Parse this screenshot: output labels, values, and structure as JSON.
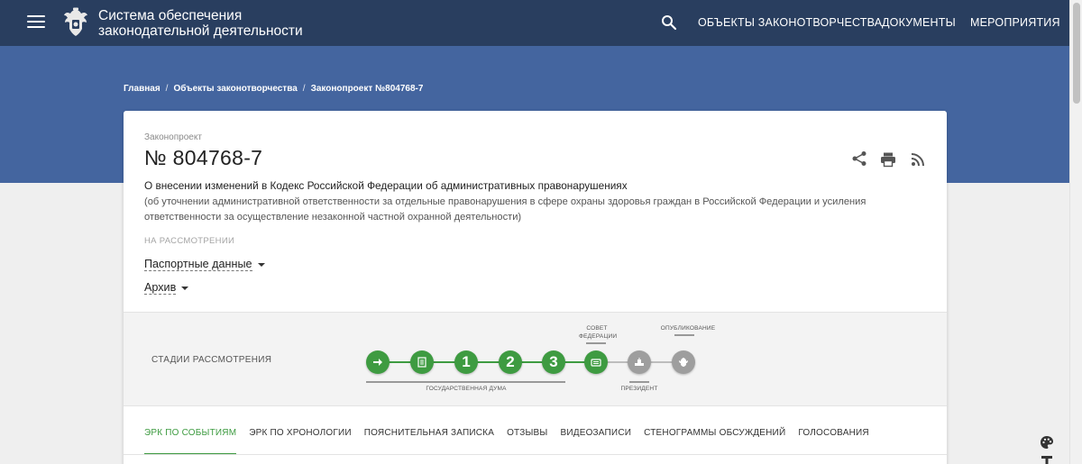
{
  "header": {
    "site_title": "Система обеспечения законодательной деятельности",
    "nav": [
      "ОБЪЕКТЫ ЗАКОНОТВОРЧЕСТВА",
      "ДОКУМЕНТЫ",
      "МЕРОПРИЯТИЯ"
    ],
    "icons": {
      "menu": "hamburger-menu-icon",
      "emblem": "coat-of-arms-emblem",
      "search": "search-icon"
    }
  },
  "breadcrumbs": [
    "Главная",
    "Объекты законотворчества",
    "Законопроект №804768-7"
  ],
  "bill": {
    "kind": "Законопроект",
    "number": "№ 804768-7",
    "title": "О внесении изменений в Кодекс Российской Федерации об административных правонарушениях",
    "subtitle": "(об уточнении административной ответственности за отдельные правонарушения в сфере охраны здоровья граждан в Российской Федерации и усиления ответственности за осуществление незаконной частной охранной деятельности)",
    "status": "НА РАССМОТРЕНИИ",
    "dropdowns": [
      "Паспортные данные",
      "Архив"
    ],
    "actions": [
      "share-icon",
      "print-icon",
      "rss-icon"
    ]
  },
  "stages": {
    "label": "СТАДИИ РАССМОТРЕНИЯ",
    "nodes": [
      {
        "label": "",
        "icon": "arrow-right-icon",
        "state": "done"
      },
      {
        "label": "",
        "icon": "document-list-icon",
        "state": "done"
      },
      {
        "label": "1",
        "icon": "",
        "state": "done"
      },
      {
        "label": "2",
        "icon": "",
        "state": "done"
      },
      {
        "label": "3",
        "icon": "",
        "state": "done"
      },
      {
        "label": "",
        "icon": "federation-council-icon",
        "state": "done"
      },
      {
        "label": "",
        "icon": "president-icon",
        "state": "pending"
      },
      {
        "label": "",
        "icon": "emblem-icon",
        "state": "pending"
      }
    ],
    "captions": {
      "council": "СОВЕТ ФЕДЕРАЦИИ",
      "publication": "ОПУБЛИКОВАНИЕ",
      "duma": "ГОСУДАРСТВЕННАЯ ДУМА",
      "president": "ПРЕЗИДЕНТ"
    },
    "colors": {
      "done": "#3e9b41",
      "pending": "#9e9e9e"
    }
  },
  "tabs": {
    "items": [
      "ЭРК ПО СОБЫТИЯМ",
      "ЭРК ПО ХРОНОЛОГИИ",
      "ПОЯСНИТЕЛЬНАЯ ЗАПИСКА",
      "ОТЗЫВЫ",
      "ВИДЕОЗАПИСИ",
      "СТЕНОГРАММЫ ОБСУЖДЕНИЙ",
      "ГОЛОСОВАНИЯ"
    ],
    "active": "ЭРК ПО СОБЫТИЯМ"
  },
  "floating": [
    "palette-icon",
    "text-format-icon"
  ]
}
